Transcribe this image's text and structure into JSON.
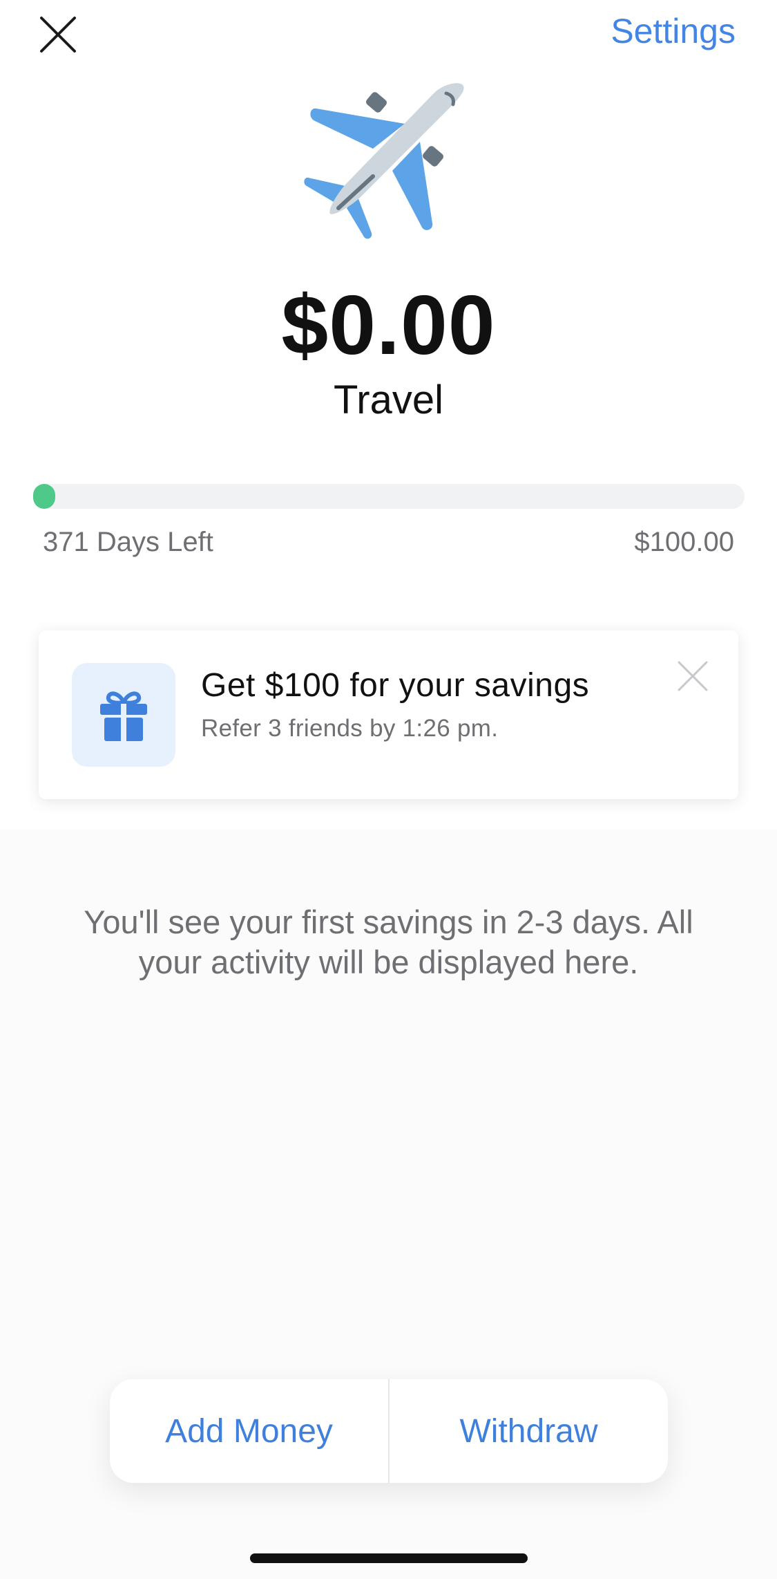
{
  "header": {
    "close_icon": "close-icon",
    "settings_label": "Settings"
  },
  "goal": {
    "emoji": "airplane",
    "amount": "$0.00",
    "name": "Travel",
    "progress_fraction": 0.0,
    "days_left": "371 Days Left",
    "target": "$100.00"
  },
  "promo": {
    "icon": "gift-icon",
    "title": "Get $100 for your savings",
    "subtitle": "Refer 3 friends by 1:26 pm.",
    "dismiss_icon": "close-icon"
  },
  "activity": {
    "empty_message": "You'll see your first savings in 2-3 days. All your activity will be displayed here."
  },
  "actions": {
    "add_money_label": "Add Money",
    "withdraw_label": "Withdraw"
  },
  "colors": {
    "accent": "#4285e5",
    "progress": "#4ec98a",
    "secondary_text": "#6e6e73"
  }
}
